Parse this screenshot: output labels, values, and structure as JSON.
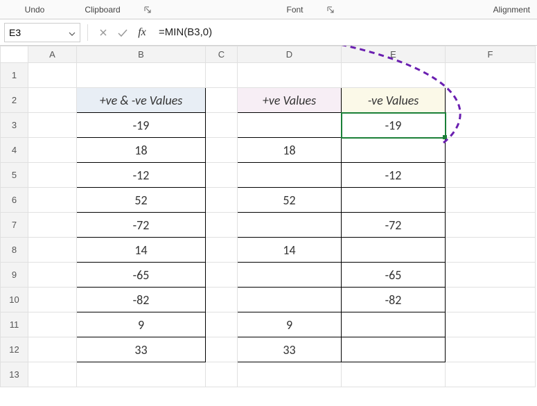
{
  "ribbon": {
    "undo": "Undo",
    "clipboard": "Clipboard",
    "font": "Font",
    "alignment": "Alignment"
  },
  "namebox": {
    "value": "E3"
  },
  "formula": {
    "value": "=MIN(B3,0)"
  },
  "columns": [
    "A",
    "B",
    "C",
    "D",
    "E",
    "F"
  ],
  "rows": [
    "1",
    "2",
    "3",
    "4",
    "5",
    "6",
    "7",
    "8",
    "9",
    "10",
    "11",
    "12",
    "13"
  ],
  "active": {
    "col": "E",
    "row": "3"
  },
  "headers": {
    "B": "+ve & -ve Values",
    "D": "+ve Values",
    "E": "-ve Values"
  },
  "chart_data": {
    "type": "table",
    "dataB": [
      "-19",
      "18",
      "-12",
      "52",
      "-72",
      "14",
      "-65",
      "-82",
      "9",
      "33"
    ],
    "dataD": [
      "",
      "18",
      "",
      "52",
      "",
      "14",
      "",
      "",
      "9",
      "33"
    ],
    "dataE": [
      "-19",
      "",
      "-12",
      "",
      "-72",
      "",
      "-65",
      "-82",
      "",
      ""
    ]
  }
}
